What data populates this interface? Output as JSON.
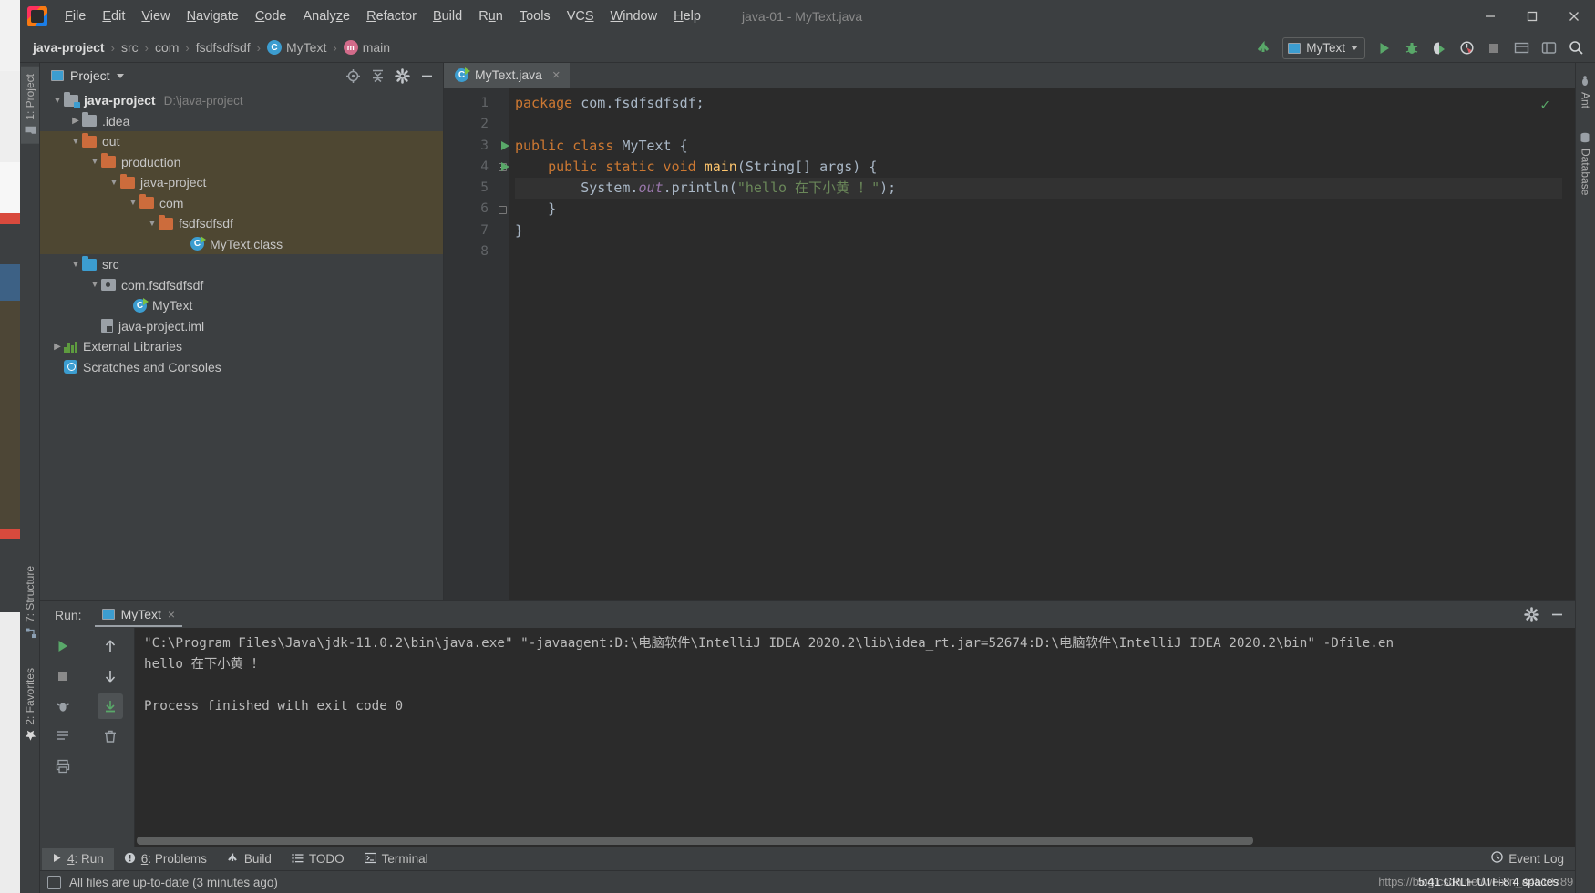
{
  "window": {
    "title": "java-01 - MyText.java",
    "controls": [
      "minimize",
      "maximize",
      "close"
    ]
  },
  "menubar": {
    "logo": "intellij-idea-logo",
    "items": [
      {
        "label": "File",
        "mnemonic": "F"
      },
      {
        "label": "Edit",
        "mnemonic": "E"
      },
      {
        "label": "View",
        "mnemonic": "V"
      },
      {
        "label": "Navigate",
        "mnemonic": "N"
      },
      {
        "label": "Code",
        "mnemonic": "C"
      },
      {
        "label": "Analyze",
        "mnemonic": "z"
      },
      {
        "label": "Refactor",
        "mnemonic": "R"
      },
      {
        "label": "Build",
        "mnemonic": "B"
      },
      {
        "label": "Run",
        "mnemonic": "u"
      },
      {
        "label": "Tools",
        "mnemonic": "T"
      },
      {
        "label": "VCS",
        "mnemonic": "S"
      },
      {
        "label": "Window",
        "mnemonic": "W"
      },
      {
        "label": "Help",
        "mnemonic": "H"
      }
    ]
  },
  "navbar": {
    "breadcrumbs": [
      {
        "label": "java-project",
        "icon": "none"
      },
      {
        "label": "src",
        "icon": "none"
      },
      {
        "label": "com",
        "icon": "none"
      },
      {
        "label": "fsdfsdfsdf",
        "icon": "none"
      },
      {
        "label": "MyText",
        "icon": "class-icon"
      },
      {
        "label": "main",
        "icon": "method-icon"
      }
    ],
    "separator": "›",
    "run_config": "MyText",
    "actions": [
      "build-project-icon",
      "run-configurations-selector",
      "run-icon",
      "debug-icon",
      "run-with-coverage-icon",
      "profiler-icon",
      "stop-icon",
      "open-settings-icon",
      "search-everywhere-icon"
    ]
  },
  "left_rail": {
    "tabs": [
      {
        "label": "1: Project",
        "active": true,
        "icon": "project-folder-icon"
      },
      {
        "label": "7: Structure",
        "active": false,
        "icon": "structure-icon"
      },
      {
        "label": "2: Favorites",
        "active": false,
        "icon": "favorites-star-icon"
      }
    ]
  },
  "right_rail": {
    "tabs": [
      {
        "label": "Ant",
        "icon": "ant-icon"
      },
      {
        "label": "Database",
        "icon": "database-icon"
      }
    ]
  },
  "project_panel": {
    "title": "Project",
    "header_actions": [
      "select-opened-file-icon",
      "collapse-all-icon",
      "settings-gear-icon",
      "hide-panel-icon"
    ],
    "tree": [
      {
        "label": "java-project",
        "path": "D:\\java-project",
        "depth": 0,
        "arrow": "down",
        "icon": "project-folder",
        "bold": true,
        "highlight": false
      },
      {
        "label": ".idea",
        "path": "",
        "depth": 1,
        "arrow": "right",
        "icon": "folder-grey",
        "bold": false,
        "highlight": false
      },
      {
        "label": "out",
        "path": "",
        "depth": 1,
        "arrow": "down",
        "icon": "folder-orange",
        "bold": false,
        "highlight": true
      },
      {
        "label": "production",
        "path": "",
        "depth": 2,
        "arrow": "down",
        "icon": "folder-orange",
        "bold": false,
        "highlight": true
      },
      {
        "label": "java-project",
        "path": "",
        "depth": 3,
        "arrow": "down",
        "icon": "folder-orange",
        "bold": false,
        "highlight": true
      },
      {
        "label": "com",
        "path": "",
        "depth": 4,
        "arrow": "down",
        "icon": "folder-orange",
        "bold": false,
        "highlight": true
      },
      {
        "label": "fsdfsdfsdf",
        "path": "",
        "depth": 5,
        "arrow": "down",
        "icon": "folder-orange",
        "bold": false,
        "highlight": true
      },
      {
        "label": "MyText.class",
        "path": "",
        "depth": 6,
        "arrow": "none",
        "icon": "class-file",
        "bold": false,
        "highlight": true
      },
      {
        "label": "src",
        "path": "",
        "depth": 1,
        "arrow": "down",
        "icon": "folder-blue",
        "bold": false,
        "highlight": false
      },
      {
        "label": "com.fsdfsdfsdf",
        "path": "",
        "depth": 2,
        "arrow": "down",
        "icon": "package",
        "bold": false,
        "highlight": false
      },
      {
        "label": "MyText",
        "path": "",
        "depth": 3,
        "arrow": "none",
        "icon": "class-file",
        "bold": false,
        "highlight": false
      },
      {
        "label": "java-project.iml",
        "path": "",
        "depth": 1,
        "arrow": "none",
        "icon": "iml-file",
        "bold": false,
        "highlight": false
      },
      {
        "label": "External Libraries",
        "path": "",
        "depth": 0,
        "arrow": "right",
        "icon": "libraries",
        "bold": false,
        "highlight": false
      },
      {
        "label": "Scratches and Consoles",
        "path": "",
        "depth": 0,
        "arrow": "none",
        "icon": "scratches",
        "bold": false,
        "highlight": false
      }
    ]
  },
  "editor": {
    "tab": {
      "label": "MyText.java",
      "icon": "java-class-icon",
      "close": "×"
    },
    "inspection_status": "✓",
    "line_numbers": [
      "1",
      "2",
      "3",
      "4",
      "5",
      "6",
      "7",
      "8"
    ],
    "gutter_run_markers": [
      3,
      4
    ],
    "current_line": 5,
    "lines": [
      {
        "n": 1,
        "tokens": [
          {
            "t": "package",
            "c": "kw"
          },
          {
            "t": " com.fsdfsdfsdf;",
            "c": "pl"
          }
        ]
      },
      {
        "n": 2,
        "tokens": []
      },
      {
        "n": 3,
        "tokens": [
          {
            "t": "public class ",
            "c": "kw"
          },
          {
            "t": "MyText ",
            "c": "pl"
          },
          {
            "t": "{",
            "c": "pl"
          }
        ]
      },
      {
        "n": 4,
        "tokens": [
          {
            "t": "    ",
            "c": "pl"
          },
          {
            "t": "public static void ",
            "c": "kw"
          },
          {
            "t": "main",
            "c": "fnm"
          },
          {
            "t": "(String[] args) {",
            "c": "pl"
          }
        ]
      },
      {
        "n": 5,
        "tokens": [
          {
            "t": "        System.",
            "c": "pl"
          },
          {
            "t": "out",
            "c": "fld-it"
          },
          {
            "t": ".println(",
            "c": "pl"
          },
          {
            "t": "\"hello 在下小黄 ！\"",
            "c": "str"
          },
          {
            "t": ");",
            "c": "pl"
          }
        ]
      },
      {
        "n": 6,
        "tokens": [
          {
            "t": "    }",
            "c": "pl"
          }
        ]
      },
      {
        "n": 7,
        "tokens": [
          {
            "t": "}",
            "c": "pl"
          }
        ]
      },
      {
        "n": 8,
        "tokens": []
      }
    ]
  },
  "run_panel": {
    "label": "Run:",
    "tab": {
      "label": "MyText",
      "icon": "run-config-icon",
      "close": "×"
    },
    "header_actions": [
      "settings-gear-icon",
      "hide-panel-icon"
    ],
    "side_actions": [
      "rerun-icon",
      "up-stack-icon",
      "stop-icon",
      "down-stack-icon",
      "soft-wrap-icon",
      "scroll-to-end-icon",
      "print-icon",
      "clear-all-icon"
    ],
    "console_lines": [
      "\"C:\\Program Files\\Java\\jdk-11.0.2\\bin\\java.exe\" \"-javaagent:D:\\电脑软件\\IntelliJ IDEA 2020.2\\lib\\idea_rt.jar=52674:D:\\电脑软件\\IntelliJ IDEA 2020.2\\bin\" -Dfile.en",
      "hello 在下小黄 ！",
      "",
      "Process finished with exit code 0"
    ]
  },
  "bottom_tabs": {
    "items": [
      {
        "label": "4: Run",
        "mnemonic": "4",
        "icon": "run-triangle-icon",
        "active": true
      },
      {
        "label": "6: Problems",
        "mnemonic": "6",
        "icon": "problems-icon",
        "active": false
      },
      {
        "label": "Build",
        "mnemonic": "",
        "icon": "build-hammer-icon",
        "active": false
      },
      {
        "label": "TODO",
        "mnemonic": "",
        "icon": "todo-list-icon",
        "active": false
      },
      {
        "label": "Terminal",
        "mnemonic": "",
        "icon": "terminal-icon",
        "active": false
      }
    ],
    "event_log": {
      "label": "Event Log",
      "icon": "event-log-icon"
    }
  },
  "statusbar": {
    "message": "All files are up-to-date (3 minutes ago)",
    "icon": "build-status-icon",
    "caret_position": "5:41",
    "encoding": "UTF-8",
    "line_separator": "CRLF",
    "indent": "4 spaces",
    "watermark_back": "https://blog.csdn.net/weixin_44519789",
    "watermark_front": "5:41 CRLF UTF-8 4 spaces"
  },
  "colors": {
    "window_bg": "#3c3f41",
    "editor_bg": "#2b2b2b",
    "gutter_bg": "#313335",
    "tree_highlight": "#4e4732",
    "accent_green": "#59a869",
    "folder_orange": "#cc6c3c",
    "folder_blue": "#3c9dd0",
    "string_green": "#6a8759",
    "keyword_orange": "#cc7832",
    "text": "#bbbbbb"
  }
}
